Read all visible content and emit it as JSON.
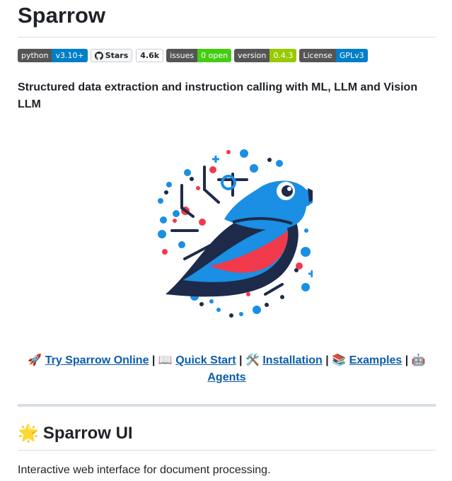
{
  "title": "Sparrow",
  "badges": [
    {
      "left": "python",
      "right": "v3.10+",
      "color": "#007ec6"
    },
    {
      "left": "issues",
      "right": "0 open",
      "color": "#4c1"
    },
    {
      "left": "version",
      "right": "0.4.3",
      "color": "#97ca00"
    },
    {
      "left": "License",
      "right": "GPLv3",
      "color": "#007ec6"
    }
  ],
  "github": {
    "label": "Stars",
    "count": "4.6k",
    "icon": "github-icon"
  },
  "description": "Structured data extraction and instruction calling with ML, LLM and Vision LLM",
  "links": {
    "try_emoji": "🚀",
    "try": "Try Sparrow Online",
    "quick_emoji": "📖",
    "quick": "Quick Start",
    "install_emoji": "🛠️",
    "install": "Installation",
    "examples_emoji": "📚",
    "examples": "Examples",
    "agents_emoji": "🤖",
    "agents": "Agents",
    "separator": "|"
  },
  "section": {
    "emoji": "🌟",
    "title": "Sparrow UI"
  },
  "intro": "Interactive web interface for document processing.",
  "colors": {
    "link": "#0b5cad",
    "accent_blue": "#1a8fe3",
    "accent_red": "#f03a4c",
    "dark": "#1e2a4a"
  }
}
